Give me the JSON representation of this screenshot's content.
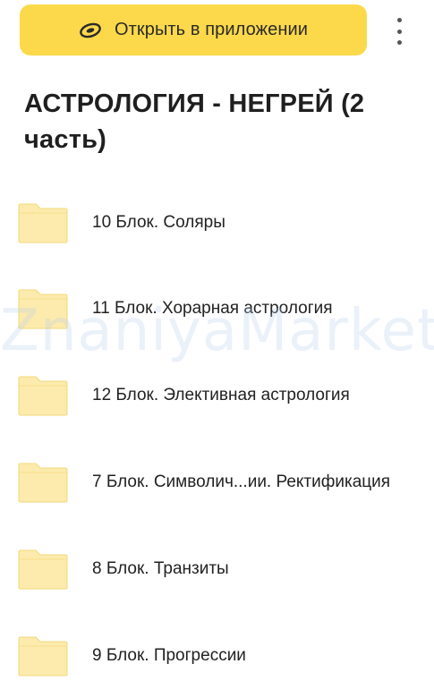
{
  "header": {
    "open_app_button": {
      "label": "Открыть в приложении",
      "icon": "disk-logo-icon",
      "color": "#fcd94a"
    },
    "menu_icon": "more-vertical-icon"
  },
  "page": {
    "title": "АСТРОЛОГИЯ - НЕГРЕЙ (2 часть)"
  },
  "folders": {
    "icon": "folder-icon",
    "icon_color": "#fcebad",
    "items": [
      {
        "name": "10 Блок. Соляры"
      },
      {
        "name": "11 Блок. Хорарная астрология"
      },
      {
        "name": "12 Блок. Элективная астрология"
      },
      {
        "name": "7 Блок. Символич...ии. Ректификация"
      },
      {
        "name": "8 Блок. Транзиты"
      },
      {
        "name": "9 Блок. Прогрессии"
      }
    ]
  },
  "watermark": {
    "text": "ZnaniyaMarket.cl"
  }
}
